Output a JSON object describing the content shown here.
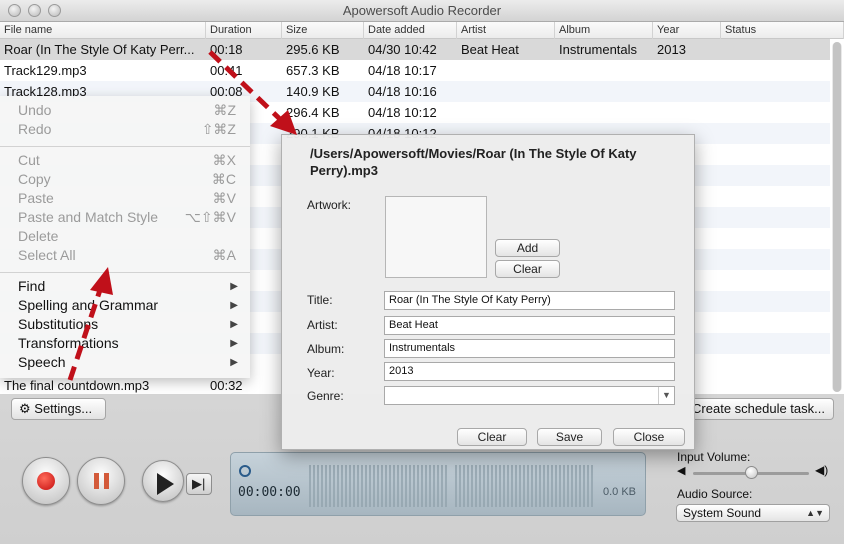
{
  "window": {
    "title": "Apowersoft Audio Recorder"
  },
  "table": {
    "columns": [
      "File name",
      "Duration",
      "Size",
      "Date added",
      "Artist",
      "Album",
      "Year",
      "Status"
    ],
    "rows": [
      {
        "name": "Roar (In The Style Of Katy Perr...",
        "duration": "00:18",
        "size": "295.6 KB",
        "date": "04/30 10:42",
        "artist": "Beat Heat",
        "album": "Instrumentals",
        "year": "2013",
        "status": ""
      },
      {
        "name": "Track129.mp3",
        "duration": "00:41",
        "size": "657.3 KB",
        "date": "04/18 10:17",
        "artist": "",
        "album": "",
        "year": "",
        "status": ""
      },
      {
        "name": "Track128.mp3",
        "duration": "00:08",
        "size": "140.9 KB",
        "date": "04/18 10:16",
        "artist": "",
        "album": "",
        "year": "",
        "status": ""
      },
      {
        "name": "",
        "duration": "",
        "size": "296.4 KB",
        "date": "04/18 10:12",
        "artist": "",
        "album": "",
        "year": "",
        "status": ""
      },
      {
        "name": "",
        "duration": "",
        "size": "290.1 KB",
        "date": "04/18 10:12",
        "artist": "",
        "album": "",
        "year": "",
        "status": ""
      }
    ],
    "last_row": {
      "name": "The final countdown.mp3",
      "duration": "00:32"
    }
  },
  "edit_menu": {
    "undo": {
      "label": "Undo",
      "shortcut": "⌘Z"
    },
    "redo": {
      "label": "Redo",
      "shortcut": "⇧⌘Z"
    },
    "cut": {
      "label": "Cut",
      "shortcut": "⌘X"
    },
    "copy": {
      "label": "Copy",
      "shortcut": "⌘C"
    },
    "paste": {
      "label": "Paste",
      "shortcut": "⌘V"
    },
    "paste_match": {
      "label": "Paste and Match Style",
      "shortcut": "⌥⇧⌘V"
    },
    "delete": {
      "label": "Delete"
    },
    "select_all": {
      "label": "Select All",
      "shortcut": "⌘A"
    },
    "find": {
      "label": "Find"
    },
    "spelling": {
      "label": "Spelling and Grammar"
    },
    "substitutions": {
      "label": "Substitutions"
    },
    "transformations": {
      "label": "Transformations"
    },
    "speech": {
      "label": "Speech"
    }
  },
  "dialog": {
    "path": "/Users/Apowersoft/Movies/Roar (In The Style Of Katy Perry).mp3",
    "artwork_label": "Artwork:",
    "add_label": "Add",
    "clear_art_label": "Clear",
    "title_label": "Title:",
    "title_value": "Roar (In The Style Of Katy Perry)",
    "artist_label": "Artist:",
    "artist_value": "Beat Heat",
    "album_label": "Album:",
    "album_value": "Instrumentals",
    "year_label": "Year:",
    "year_value": "2013",
    "genre_label": "Genre:",
    "genre_value": "",
    "clear_label": "Clear",
    "save_label": "Save",
    "close_label": "Close"
  },
  "toolbar": {
    "settings_label": "Settings...",
    "schedule_label": "Create schedule task..."
  },
  "player": {
    "timer": "00:00:00",
    "size": "0.0 KB",
    "input_volume_label": "Input Volume:",
    "input_volume_level": 0.5,
    "audio_source_label": "Audio Source:",
    "audio_source_value": "System Sound"
  },
  "colors": {
    "annotation_arrow": "#c0101a",
    "record": "#d81818",
    "pause": "#d35a3a"
  }
}
